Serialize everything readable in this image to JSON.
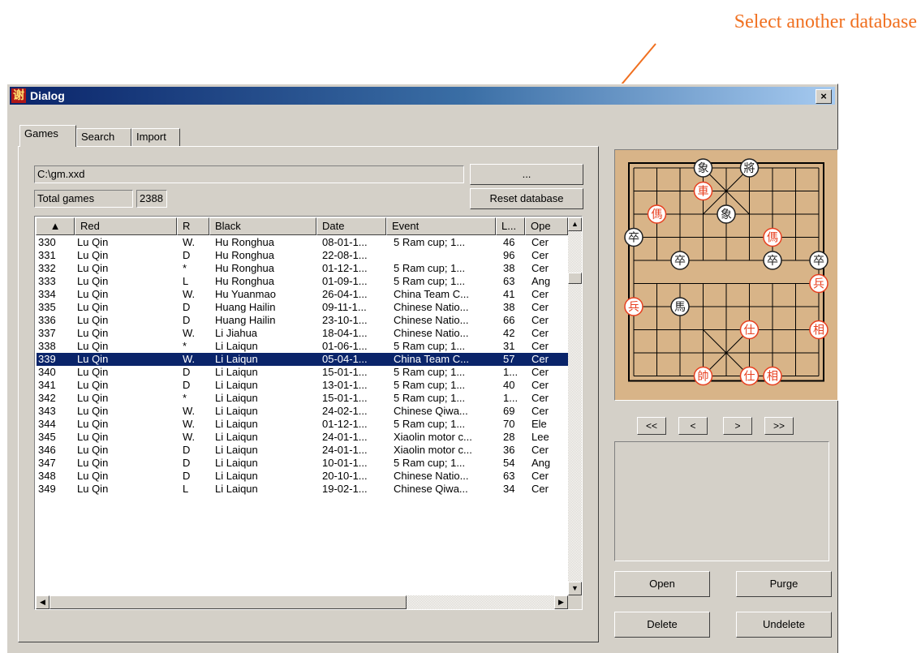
{
  "annotation": {
    "text": "Select another database",
    "color": "#f07020"
  },
  "window": {
    "title": "Dialog",
    "icon_char": "谢",
    "icon": "xie-app-icon",
    "close_label": "×"
  },
  "tabs": [
    {
      "label": "Games",
      "active": true
    },
    {
      "label": "Search"
    },
    {
      "label": "Import"
    }
  ],
  "database": {
    "path": "C:\\gm.xxd",
    "browse_label": "...",
    "total_label": "Total games",
    "total_value": "2388",
    "reset_label": "Reset database"
  },
  "table": {
    "columns": [
      "",
      "Red",
      "R",
      "Black",
      "Date",
      "Event",
      "L...",
      "Ope"
    ],
    "sort_icon": "sort-ascending-triangle",
    "rows": [
      [
        "330",
        "Lu Qin",
        "W.",
        "Hu Ronghua",
        "08-01-1...",
        "5 Ram cup; 1...",
        "46",
        "Cer"
      ],
      [
        "331",
        "Lu Qin",
        "D",
        "Hu Ronghua",
        "22-08-1...",
        "",
        "96",
        "Cer"
      ],
      [
        "332",
        "Lu Qin",
        "*",
        "Hu Ronghua",
        "01-12-1...",
        "5 Ram cup; 1...",
        "38",
        "Cer"
      ],
      [
        "333",
        "Lu Qin",
        "L",
        "Hu Ronghua",
        "01-09-1...",
        "5 Ram cup; 1...",
        "63",
        "Ang"
      ],
      [
        "334",
        "Lu Qin",
        "W.",
        "Hu Yuanmao",
        "26-04-1...",
        "China Team C...",
        "41",
        "Cer"
      ],
      [
        "335",
        "Lu Qin",
        "D",
        "Huang Hailin",
        "09-11-1...",
        "Chinese Natio...",
        "38",
        "Cer"
      ],
      [
        "336",
        "Lu Qin",
        "D",
        "Huang Hailin",
        "23-10-1...",
        "Chinese Natio...",
        "66",
        "Cer"
      ],
      [
        "337",
        "Lu Qin",
        "W.",
        "Li Jiahua",
        "18-04-1...",
        "Chinese Natio...",
        "42",
        "Cer"
      ],
      [
        "338",
        "Lu Qin",
        "*",
        "Li Laiqun",
        "01-06-1...",
        "5 Ram cup; 1...",
        "31",
        "Cer"
      ],
      [
        "339",
        "Lu Qin",
        "W.",
        "Li Laiqun",
        "05-04-1...",
        "China Team C...",
        "57",
        "Cer"
      ],
      [
        "340",
        "Lu Qin",
        "D",
        "Li Laiqun",
        "15-01-1...",
        "5 Ram cup; 1...",
        "1...",
        "Cer"
      ],
      [
        "341",
        "Lu Qin",
        "D",
        "Li Laiqun",
        "13-01-1...",
        "5 Ram cup; 1...",
        "40",
        "Cer"
      ],
      [
        "342",
        "Lu Qin",
        "*",
        "Li Laiqun",
        "15-01-1...",
        "5 Ram cup; 1...",
        "1...",
        "Cer"
      ],
      [
        "343",
        "Lu Qin",
        "W.",
        "Li Laiqun",
        "24-02-1...",
        "Chinese Qiwa...",
        "69",
        "Cer"
      ],
      [
        "344",
        "Lu Qin",
        "W.",
        "Li Laiqun",
        "01-12-1...",
        "5 Ram cup; 1...",
        "70",
        "Ele"
      ],
      [
        "345",
        "Lu Qin",
        "W.",
        "Li Laiqun",
        "24-01-1...",
        "Xiaolin motor c...",
        "28",
        "Lee"
      ],
      [
        "346",
        "Lu Qin",
        "D",
        "Li Laiqun",
        "24-01-1...",
        "Xiaolin motor c...",
        "36",
        "Cer"
      ],
      [
        "347",
        "Lu Qin",
        "D",
        "Li Laiqun",
        "10-01-1...",
        "5 Ram cup; 1...",
        "54",
        "Ang"
      ],
      [
        "348",
        "Lu Qin",
        "D",
        "Li Laiqun",
        "20-10-1...",
        "Chinese Natio...",
        "63",
        "Cer"
      ],
      [
        "349",
        "Lu Qin",
        "L",
        "Li Laiqun",
        "19-02-1...",
        "Chinese Qiwa...",
        "34",
        "Cer"
      ]
    ],
    "selected_row": 9
  },
  "board": {
    "colors": {
      "board": "#d8b488",
      "red": "#e84020",
      "black": "#202020"
    },
    "pieces": [
      {
        "side": "black",
        "char": "象",
        "file": 3,
        "rank": 0
      },
      {
        "side": "black",
        "char": "將",
        "file": 5,
        "rank": 0
      },
      {
        "side": "red",
        "char": "車",
        "file": 3,
        "rank": 1
      },
      {
        "side": "red",
        "char": "傌",
        "file": 1,
        "rank": 2
      },
      {
        "side": "black",
        "char": "象",
        "file": 4,
        "rank": 2
      },
      {
        "side": "black",
        "char": "卒",
        "file": 0,
        "rank": 3
      },
      {
        "side": "red",
        "char": "傌",
        "file": 6,
        "rank": 3
      },
      {
        "side": "black",
        "char": "卒",
        "file": 2,
        "rank": 4
      },
      {
        "side": "black",
        "char": "卒",
        "file": 6,
        "rank": 4
      },
      {
        "side": "black",
        "char": "卒",
        "file": 8,
        "rank": 4
      },
      {
        "side": "red",
        "char": "兵",
        "file": 8,
        "rank": 5
      },
      {
        "side": "red",
        "char": "兵",
        "file": 0,
        "rank": 6
      },
      {
        "side": "black",
        "char": "馬",
        "file": 2,
        "rank": 6
      },
      {
        "side": "red",
        "char": "仕",
        "file": 5,
        "rank": 7
      },
      {
        "side": "red",
        "char": "相",
        "file": 8,
        "rank": 7
      },
      {
        "side": "red",
        "char": "帥",
        "file": 3,
        "rank": 9
      },
      {
        "side": "red",
        "char": "仕",
        "file": 5,
        "rank": 9
      },
      {
        "side": "red",
        "char": "相",
        "file": 6,
        "rank": 9
      }
    ]
  },
  "navigation": {
    "first": "<<",
    "prev": "<",
    "next": ">",
    "last": ">>"
  },
  "actions": {
    "open": "Open",
    "purge": "Purge",
    "delete": "Delete",
    "undelete": "Undelete"
  }
}
